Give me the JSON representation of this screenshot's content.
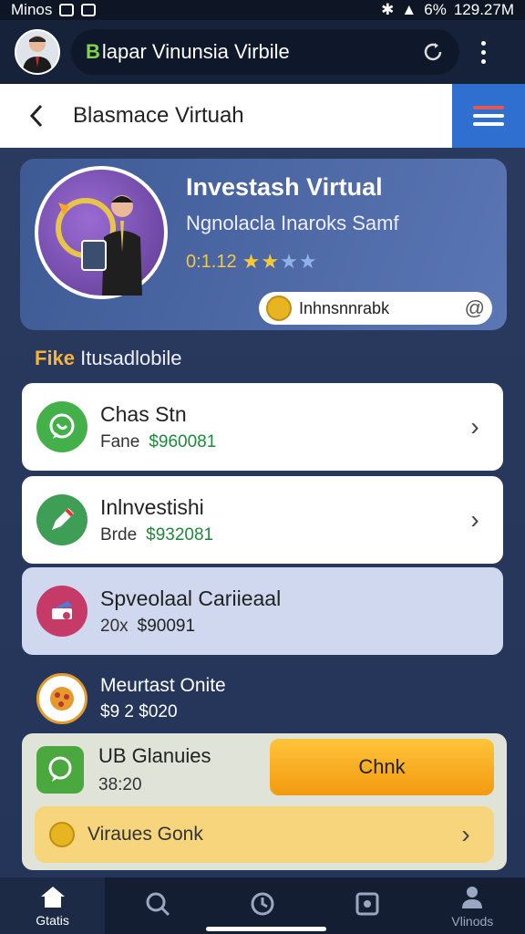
{
  "status_bar": {
    "left_text": "Minos",
    "right_text": "129.27M",
    "battery": "6%"
  },
  "app_bar": {
    "search_prefix": "B",
    "search_text": "lapar Vinunsia Virbile"
  },
  "header": {
    "title": "Blasmace Virtuah"
  },
  "hero": {
    "title": "Investash Virtual",
    "subtitle": "Ngnolacla Inaroks Samf",
    "rating_value": "0:1.12",
    "rating_stars": 2,
    "rating_max": 4,
    "pill_label": "Inhnsnnrabk"
  },
  "section": {
    "accent": "Fike",
    "label": "Itusadlobile"
  },
  "cards": [
    {
      "title": "Chas Stn",
      "meta_label": "Fane",
      "amount": "$960081",
      "style": "white",
      "icon": "chat-icon",
      "color": "#43b04a"
    },
    {
      "title": "Inlnvestishi",
      "meta_label": "Brde",
      "amount": "$932081",
      "style": "white",
      "icon": "pen-icon",
      "color": "#3f9e55"
    },
    {
      "title": "Spveolaal Cariieaal",
      "meta_label": "20x",
      "amount": "$90091",
      "style": "light",
      "icon": "tag-icon",
      "color": "#c53a66"
    }
  ],
  "plain_row": {
    "title": "Meurtast Onite",
    "meta": "$9 2 $020",
    "icon": "pizza-icon"
  },
  "bottom_card": {
    "title": "UB Glanuies",
    "subtitle": "38:20",
    "action_label": "Chnk",
    "wide_label": "Viraues Gonk"
  },
  "nav": [
    {
      "label": "Gtatis",
      "icon": "home-icon",
      "active": true
    },
    {
      "label": "",
      "icon": "search-icon",
      "active": false
    },
    {
      "label": "",
      "icon": "clock-icon",
      "active": false
    },
    {
      "label": "",
      "icon": "image-icon",
      "active": false
    },
    {
      "label": "Vlinods",
      "icon": "profile-icon",
      "active": false
    }
  ],
  "colors": {
    "accent_blue": "#2f6fcf",
    "accent_orange": "#f29a10",
    "amount_green": "#1c8a3c"
  }
}
